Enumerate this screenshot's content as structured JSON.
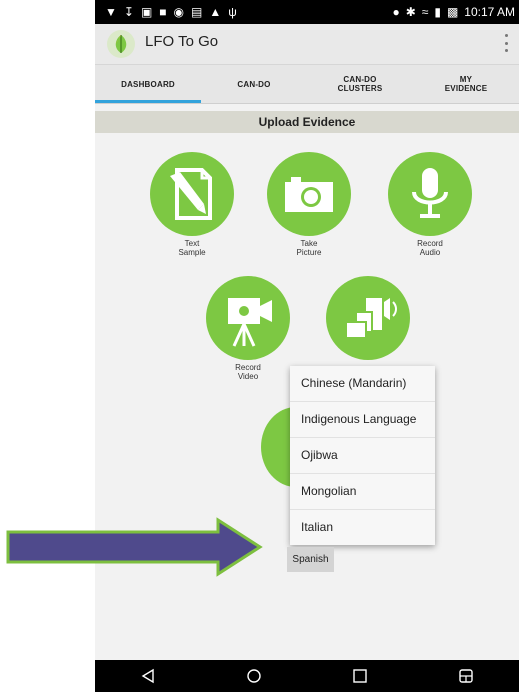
{
  "status_bar": {
    "notification_icons": [
      "wifi-icon",
      "download-icon",
      "image-icon",
      "app-icon",
      "camera-icon",
      "photo-icon",
      "android-icon",
      "usb-icon"
    ],
    "time": "10:17 AM"
  },
  "app": {
    "title": "LFO To Go"
  },
  "tabs": [
    {
      "label": "DASHBOARD",
      "active": true
    },
    {
      "label": "CAN-DO",
      "active": false
    },
    {
      "label": "CAN-DO\nCLUSTERS",
      "active": false
    },
    {
      "label": "MY\nEVIDENCE",
      "active": false
    }
  ],
  "section_title": "Upload Evidence",
  "actions": [
    {
      "label": "Text\nSample",
      "icon": "pencil-page-icon"
    },
    {
      "label": "Take\nPicture",
      "icon": "camera-icon"
    },
    {
      "label": "Record\nAudio",
      "icon": "microphone-icon"
    },
    {
      "label": "Record\nVideo",
      "icon": "video-camera-icon"
    },
    {
      "label": "",
      "icon": "media-collage-icon"
    }
  ],
  "language_dropdown": {
    "options": [
      "Chinese (Mandarin)",
      "Indigenous Language",
      "Ojibwa",
      "Mongolian",
      "Italian"
    ],
    "selected": "Spanish"
  },
  "nav_bar": [
    "back-icon",
    "home-icon",
    "recents-icon",
    "split-screen-icon"
  ],
  "colors": {
    "accent_green": "#7dc843",
    "tab_indicator": "#33a3dc",
    "arrow_fill": "#4f4a8c",
    "arrow_border": "#7dbf3f"
  }
}
